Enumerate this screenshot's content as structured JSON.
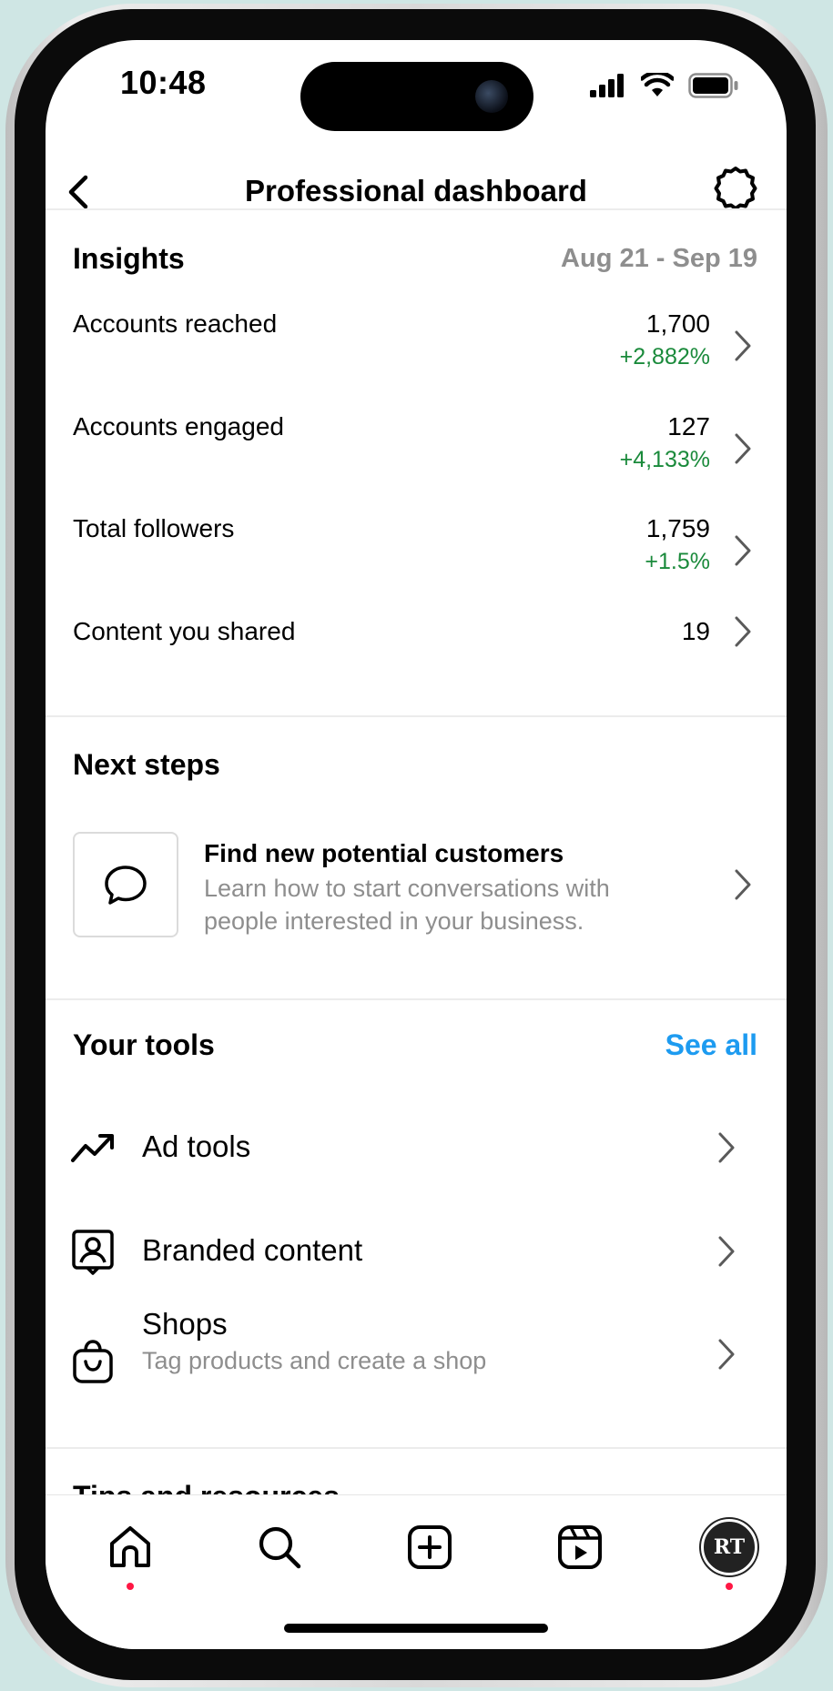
{
  "status_bar": {
    "time": "10:48"
  },
  "header": {
    "title": "Professional dashboard"
  },
  "insights": {
    "title": "Insights",
    "date_range": "Aug 21 - Sep 19",
    "metrics": [
      {
        "label": "Accounts reached",
        "value": "1,700",
        "change": "+2,882%"
      },
      {
        "label": "Accounts engaged",
        "value": "127",
        "change": "+4,133%"
      },
      {
        "label": "Total followers",
        "value": "1,759",
        "change": "+1.5%"
      },
      {
        "label": "Content you shared",
        "value": "19",
        "change": ""
      }
    ]
  },
  "next_steps": {
    "title": "Next steps",
    "card": {
      "title": "Find new potential customers",
      "description": "Learn how to start conversations with people interested in your business."
    }
  },
  "tools": {
    "title": "Your tools",
    "see_all": "See all",
    "items": [
      {
        "label": "Ad tools",
        "icon": "trending-up-icon"
      },
      {
        "label": "Branded content",
        "icon": "branded-content-icon"
      },
      {
        "label": "Shops",
        "sublabel": "Tag products and create a shop",
        "icon": "shopping-bag-icon"
      }
    ]
  },
  "peek_section": {
    "title": "Tips and resources"
  },
  "tab_bar": {
    "avatar_initials": "RT"
  },
  "colors": {
    "positive": "#1a8a3b",
    "link": "#1d9bf0",
    "muted": "#8e8e8e",
    "notification": "#ff1744"
  }
}
